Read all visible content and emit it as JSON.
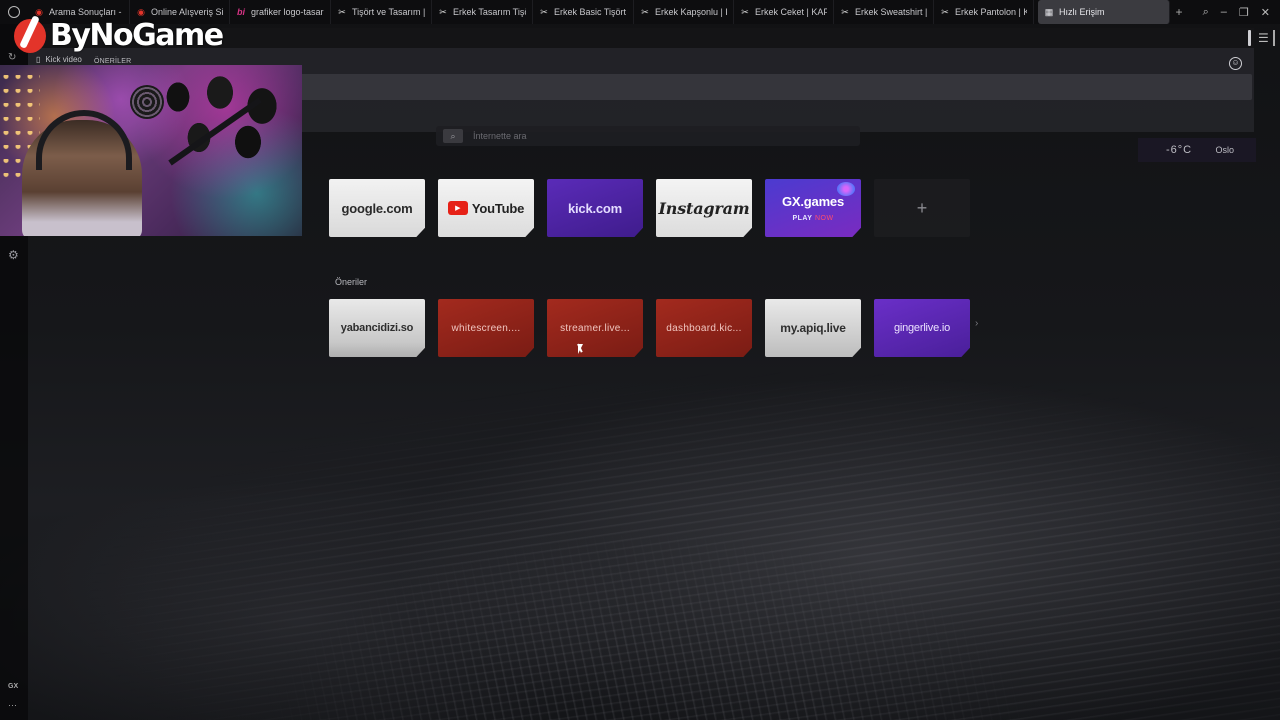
{
  "overlay": {
    "logo_text": "ByNoGame"
  },
  "tabs": [
    {
      "label": "Arama Sonuçları -",
      "icon": "opera-search-icon",
      "color": "#e3342a"
    },
    {
      "label": "Online Alışveriş Sit",
      "icon": "shop-icon",
      "color": "#e3342a"
    },
    {
      "label": "grafiker logo-tasarı",
      "icon": "bionluk-icon",
      "color": "#d63384"
    },
    {
      "label": "Tişört ve Tasarım |",
      "icon": "scissors-icon",
      "color": "#dddddd"
    },
    {
      "label": "Erkek Tasarım Tişör",
      "icon": "scissors-icon",
      "color": "#dddddd"
    },
    {
      "label": "Erkek Basic Tişört",
      "icon": "scissors-icon",
      "color": "#dddddd"
    },
    {
      "label": "Erkek Kapşonlu | K",
      "icon": "scissors-icon",
      "color": "#dddddd"
    },
    {
      "label": "Erkek Ceket | KAF",
      "icon": "scissors-icon",
      "color": "#dddddd"
    },
    {
      "label": "Erkek Sweatshirt |",
      "icon": "scissors-icon",
      "color": "#dddddd"
    },
    {
      "label": "Erkek Pantolon | K",
      "icon": "scissors-icon",
      "color": "#dddddd"
    }
  ],
  "active_tab": {
    "label": "Hızlı Erişim",
    "icon": "grid-icon"
  },
  "bookmarks_bar": {
    "item": "Kick video",
    "suggestions_tiny": "ÖNERİLER"
  },
  "search": {
    "placeholder": "İnternette ara"
  },
  "weather": {
    "temp": "-6°C",
    "city": "Oslo"
  },
  "speed_dial": [
    {
      "label": "google.com",
      "style": "light"
    },
    {
      "label": "YouTube",
      "style": "yt"
    },
    {
      "label": "kick.com",
      "style": "kick"
    },
    {
      "label": "Instagram",
      "style": "insta"
    },
    {
      "label": "GX.games",
      "style": "gx",
      "sub": "PLAY",
      "sub2": "NOW"
    }
  ],
  "add_tile": "+",
  "suggestions_heading": "Öneriler",
  "suggestions": [
    {
      "label": "yabancidizi.so",
      "style": "gray"
    },
    {
      "label": "whitescreen....",
      "style": "red"
    },
    {
      "label": "streamer.live...",
      "style": "red"
    },
    {
      "label": "dashboard.kic...",
      "style": "red"
    },
    {
      "label": "my.apiq.live",
      "style": "apiq"
    },
    {
      "label": "gingerlive.io",
      "style": "purple"
    }
  ],
  "sidebar": {
    "gx_label": "GX",
    "more_label": "···"
  }
}
